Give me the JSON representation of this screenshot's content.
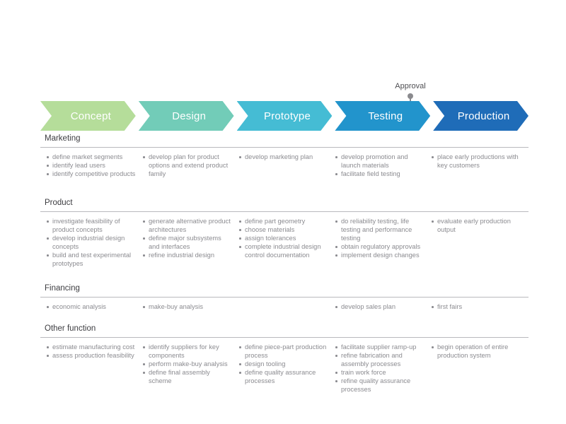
{
  "approval": {
    "label": "Approval",
    "marker_color": "#8a8a8e"
  },
  "phases": [
    {
      "label": "Concept",
      "color": "#b5dd9a"
    },
    {
      "label": "Design",
      "color": "#72ccb8"
    },
    {
      "label": "Prototype",
      "color": "#45bcd4"
    },
    {
      "label": "Testing",
      "color": "#2294cc"
    },
    {
      "label": "Production",
      "color": "#1f6cb8"
    }
  ],
  "rows": [
    {
      "heading": "Marketing",
      "columns": [
        {
          "items": [
            "define market segments",
            "identify lead users",
            "identify competitive products"
          ]
        },
        {
          "items": [
            "develop plan for product options and extend product family"
          ]
        },
        {
          "items": [
            "develop marketing plan"
          ]
        },
        {
          "items": [
            "develop promotion and launch materials",
            "facilitate field testing"
          ]
        },
        {
          "items": [
            "place early productions with key customers"
          ]
        }
      ]
    },
    {
      "heading": "Product",
      "columns": [
        {
          "items": [
            "investigate feasibility of product concepts",
            "develop industrial design concepts",
            "build and test experimental prototypes"
          ]
        },
        {
          "items": [
            "generate alternative product architectures",
            "define major subsystems and interfaces",
            "refine industrial design"
          ]
        },
        {
          "items": [
            "define part geometry",
            "choose materials",
            "assign tolerances",
            "complete industrial design control documentation"
          ]
        },
        {
          "items": [
            "do reliability testing, life testing and performance testing",
            "obtain regulatory approvals",
            "implement design changes"
          ]
        },
        {
          "items": [
            "evaluate early production output"
          ]
        }
      ]
    },
    {
      "heading": "Financing",
      "columns": [
        {
          "items": [
            "economic analysis"
          ]
        },
        {
          "items": [
            "make-buy analysis"
          ]
        },
        {
          "items": []
        },
        {
          "items": [
            "develop sales plan"
          ]
        },
        {
          "items": [
            "first fairs"
          ]
        }
      ]
    },
    {
      "heading": "Other function",
      "columns": [
        {
          "items": [
            "estimate manufacturing cost",
            "assess production feasibility"
          ]
        },
        {
          "items": [
            "identify suppliers for key components",
            "perform make-buy analysis",
            "define final assembly scheme"
          ]
        },
        {
          "items": [
            "define piece-part production process",
            "design tooling",
            "define quality assurance processes"
          ]
        },
        {
          "items": [
            "facilitate supplier ramp-up",
            "refine fabrication and assembly processes",
            "train work force",
            "refine quality assurance processes"
          ]
        },
        {
          "items": [
            "begin operation of entire production system"
          ]
        }
      ]
    }
  ]
}
